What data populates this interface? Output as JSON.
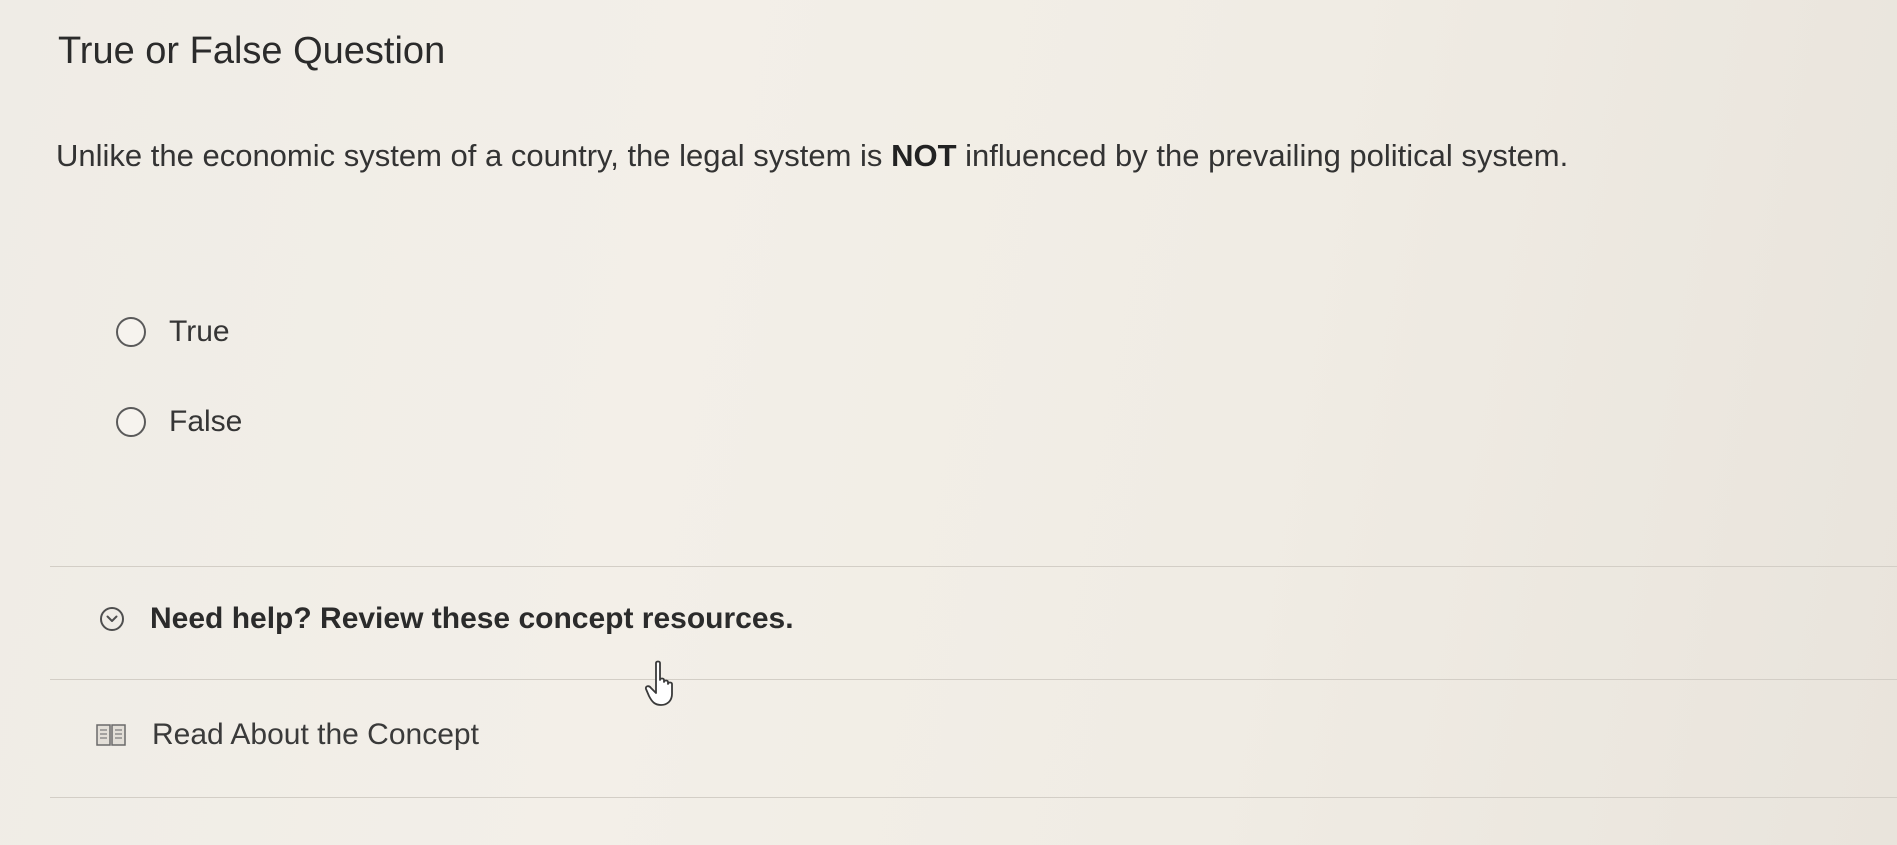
{
  "question": {
    "title": "True or False Question",
    "text_before": "Unlike the economic system of a country, the legal system is ",
    "text_emphasis": "NOT",
    "text_after": " influenced by the prevailing political system."
  },
  "options": [
    {
      "label": "True",
      "selected": false
    },
    {
      "label": "False",
      "selected": false
    }
  ],
  "help": {
    "label": "Need help? Review these concept resources.",
    "icon": "chevron-down-circle-icon"
  },
  "resources": [
    {
      "label": "Read About the Concept",
      "icon": "book-icon"
    }
  ],
  "colors": {
    "background": "#f0ece4",
    "text": "#2e2e2e",
    "divider": "#d3cec6"
  }
}
